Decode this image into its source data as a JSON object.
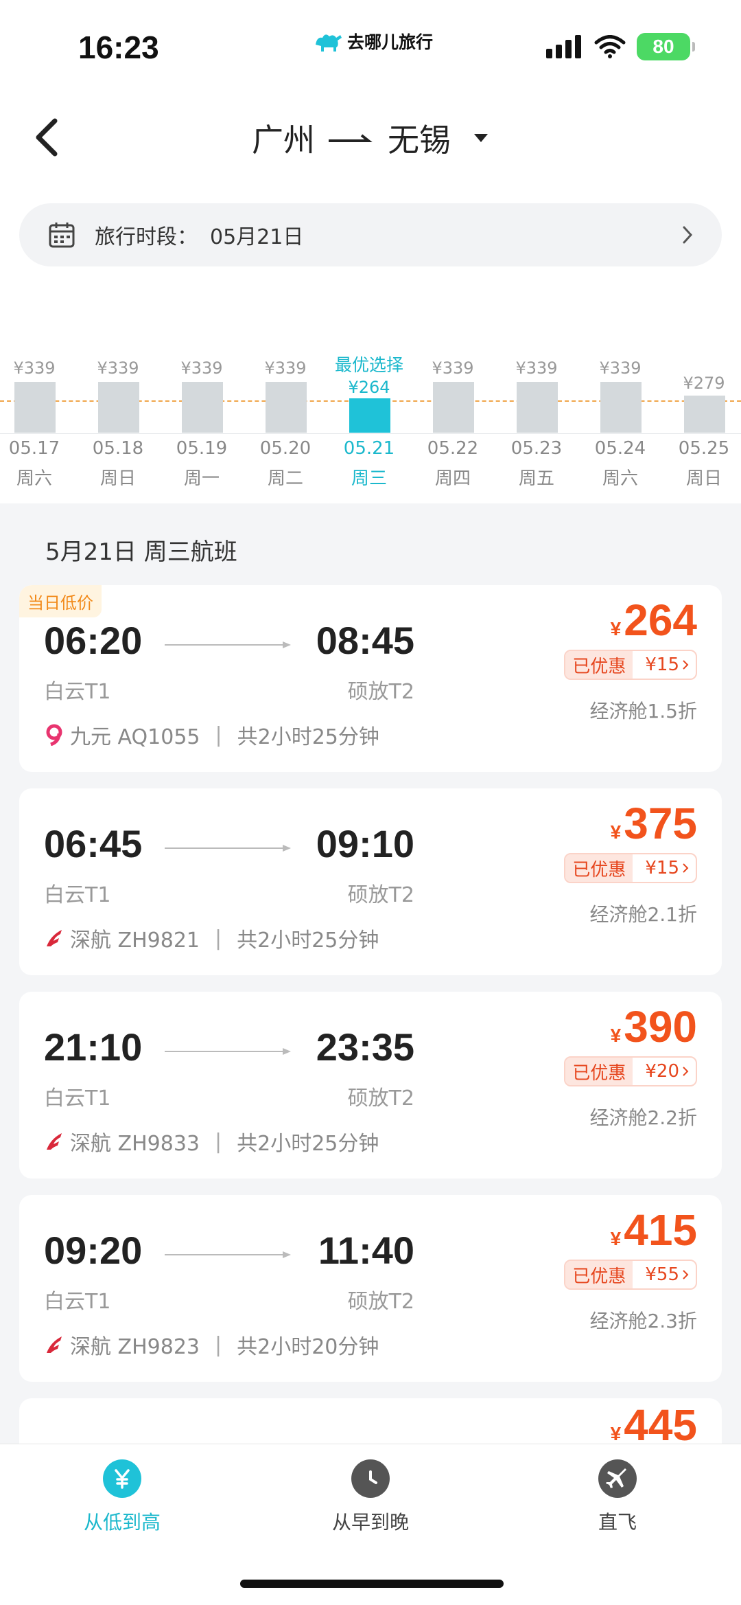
{
  "status": {
    "time": "16:23",
    "carrier": "去哪儿旅行",
    "battery": "80"
  },
  "header": {
    "from": "广州",
    "to": "无锡"
  },
  "period": {
    "label": "旅行时段：",
    "value": "05月21日"
  },
  "calendar": [
    {
      "price": "¥339",
      "date": "05.17",
      "weekday": "周六"
    },
    {
      "price": "¥339",
      "date": "05.18",
      "weekday": "周日"
    },
    {
      "price": "¥339",
      "date": "05.19",
      "weekday": "周一"
    },
    {
      "price": "¥339",
      "date": "05.20",
      "weekday": "周二"
    },
    {
      "price": "¥264",
      "date": "05.21",
      "weekday": "周三",
      "tag": "最优选择",
      "selected": true
    },
    {
      "price": "¥339",
      "date": "05.22",
      "weekday": "周四"
    },
    {
      "price": "¥339",
      "date": "05.23",
      "weekday": "周五"
    },
    {
      "price": "¥339",
      "date": "05.24",
      "weekday": "周六"
    },
    {
      "price": "¥279",
      "date": "05.25",
      "weekday": "周日"
    }
  ],
  "section_title": "5月21日 周三航班",
  "flights": [
    {
      "badge": "当日低价",
      "dep": "06:20",
      "arr": "08:45",
      "dep_terminal": "白云T1",
      "arr_terminal": "硕放T2",
      "airline": "九元 AQ1055",
      "duration": "共2小时25分钟",
      "yen": "¥",
      "price": "264",
      "discount_label": "已优惠",
      "discount": "¥15",
      "cabin": "经济舱1.5折",
      "logo": "jiuyuan"
    },
    {
      "dep": "06:45",
      "arr": "09:10",
      "dep_terminal": "白云T1",
      "arr_terminal": "硕放T2",
      "airline": "深航 ZH9821",
      "duration": "共2小时25分钟",
      "yen": "¥",
      "price": "375",
      "discount_label": "已优惠",
      "discount": "¥15",
      "cabin": "经济舱2.1折",
      "logo": "shenhang"
    },
    {
      "dep": "21:10",
      "arr": "23:35",
      "dep_terminal": "白云T1",
      "arr_terminal": "硕放T2",
      "airline": "深航 ZH9833",
      "duration": "共2小时25分钟",
      "yen": "¥",
      "price": "390",
      "discount_label": "已优惠",
      "discount": "¥20",
      "cabin": "经济舱2.2折",
      "logo": "shenhang"
    },
    {
      "dep": "09:20",
      "arr": "11:40",
      "dep_terminal": "白云T1",
      "arr_terminal": "硕放T2",
      "airline": "深航 ZH9823",
      "duration": "共2小时20分钟",
      "yen": "¥",
      "price": "415",
      "discount_label": "已优惠",
      "discount": "¥55",
      "cabin": "经济舱2.3折",
      "logo": "shenhang"
    },
    {
      "yen": "¥",
      "price": "445"
    }
  ],
  "tabs": [
    {
      "label": "从低到高",
      "icon": "yen-icon",
      "active": true
    },
    {
      "label": "从早到晚",
      "icon": "clock-icon"
    },
    {
      "label": "直飞",
      "icon": "plane-icon"
    }
  ],
  "colors": {
    "accent": "#1fc2d8",
    "price": "#f2531c",
    "badge": "#f28a1a"
  }
}
